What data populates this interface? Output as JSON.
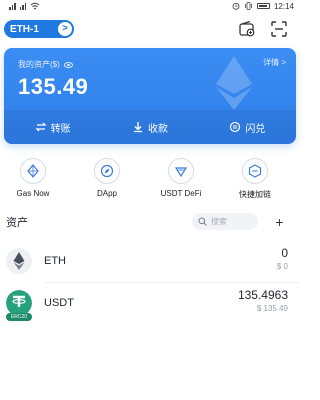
{
  "status_bar": {
    "time": "12:14",
    "icons": [
      "signal-icon",
      "signal-icon",
      "wifi-icon",
      "alarm-icon",
      "vibrate-icon",
      "battery-icon"
    ]
  },
  "header": {
    "wallet_name": "ETH-1",
    "chevron_glyph": ">",
    "icons": [
      "wallet-switch-icon",
      "scan-icon"
    ]
  },
  "asset_card": {
    "label": "我的资产($)",
    "value": "135.49",
    "detail_link": "详情 >",
    "actions": [
      {
        "label": "转账",
        "icon": "transfer-icon"
      },
      {
        "label": "收款",
        "icon": "receive-icon"
      },
      {
        "label": "闪兑",
        "icon": "swap-icon"
      }
    ],
    "colors": {
      "card": "#2e7de9",
      "text": "#ffffff"
    }
  },
  "features": [
    {
      "label": "Gas Now",
      "icon": "gas-icon"
    },
    {
      "label": "DApp",
      "icon": "compass-icon"
    },
    {
      "label": "USDT DeFi",
      "icon": "defi-icon"
    },
    {
      "label": "快捷加链",
      "icon": "add-chain-icon"
    }
  ],
  "assets": {
    "title": "资产",
    "search_placeholder": "搜索",
    "add_glyph": "+",
    "items": [
      {
        "symbol": "ETH",
        "amount": "0",
        "fiat": "$ 0",
        "icon": "eth-icon"
      },
      {
        "symbol": "USDT",
        "amount": "135.4963",
        "fiat": "$ 135.49",
        "icon": "usdt-icon",
        "badge": "ERC20"
      }
    ]
  },
  "colors": {
    "accent": "#1f7ae0",
    "usdt_green": "#26a17b",
    "text_primary": "#1f2430",
    "text_muted": "#9aa0ab"
  }
}
